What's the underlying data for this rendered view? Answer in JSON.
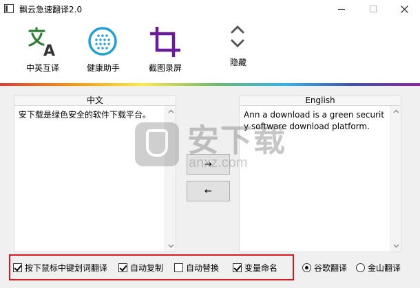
{
  "window": {
    "title": "飘云急速翻译2.0",
    "controls": {
      "minimize": "minimize",
      "maximize": "maximize",
      "close": "close"
    }
  },
  "toolbar": {
    "items": [
      {
        "label": "中英互译",
        "icon": "translate-icon"
      },
      {
        "label": "健康助手",
        "icon": "health-assistant-icon"
      },
      {
        "label": "截图录屏",
        "icon": "crop-icon"
      },
      {
        "label": "隐藏",
        "icon": "chevron-up-down-icon"
      }
    ]
  },
  "panels": {
    "source": {
      "header": "中文",
      "text": "安下载是绿色安全的软件下载平台。"
    },
    "target": {
      "header": "English",
      "text": "Ann a download is a green security software download platform."
    }
  },
  "buttons": {
    "zh_to_en": "→",
    "en_to_zh": "←"
  },
  "watermark": {
    "title": "安下载",
    "subtitle": "anxz.com"
  },
  "options": {
    "checkboxes": [
      {
        "label": "按下鼠标中键划词翻译",
        "checked": true
      },
      {
        "label": "自动复制",
        "checked": true
      },
      {
        "label": "自动替换",
        "checked": false
      },
      {
        "label": "变量命名",
        "checked": true
      }
    ],
    "engines": [
      {
        "label": "谷歌翻译",
        "selected": true
      },
      {
        "label": "金山翻译",
        "selected": false
      }
    ]
  },
  "colors": {
    "translate_icon_green": "#2e7d32",
    "health_icon_blue": "#1da1d6",
    "crop_icon_purple": "#6a1b9a",
    "highlight_red": "#d7181e"
  }
}
